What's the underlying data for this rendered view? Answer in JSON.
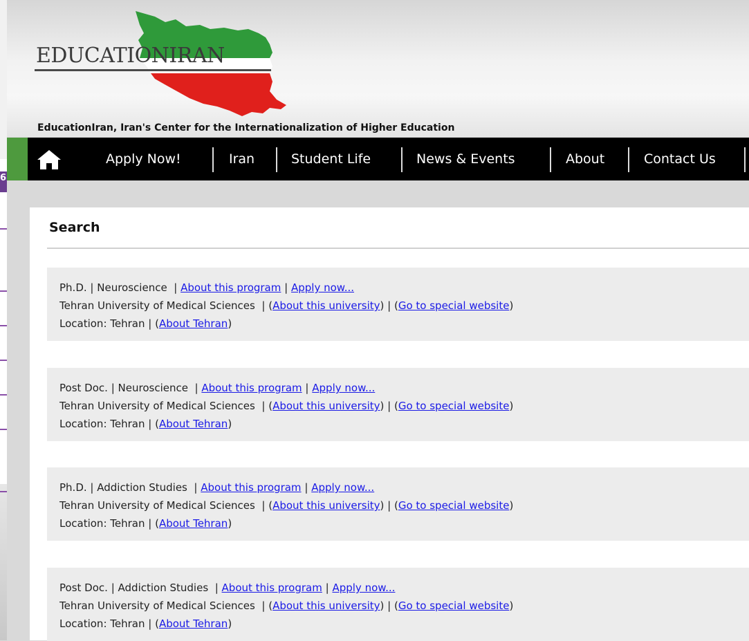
{
  "site": {
    "logo_text": "EDUCATIONIRAN",
    "tagline": "EducationIran, Iran's Center for the Internationalization of Higher Education",
    "left_tab_char": "6"
  },
  "nav": {
    "home_icon": "home-icon",
    "items": [
      {
        "label": "Apply Now!"
      },
      {
        "label": "Iran"
      },
      {
        "label": "Student Life"
      },
      {
        "label": "News & Events"
      },
      {
        "label": "About"
      },
      {
        "label": "Contact Us"
      }
    ]
  },
  "search": {
    "title": "Search"
  },
  "labels": {
    "sep": "|",
    "about_program": "About this program",
    "apply_now": "Apply now...",
    "about_university": "About this university",
    "special_website": "Go to special website",
    "location_prefix": "Location:",
    "about_city_prefix": "About"
  },
  "results": [
    {
      "degree": "Ph.D.",
      "field": "Neuroscience",
      "university": "Tehran University of Medical Sciences",
      "location": "Tehran",
      "about_city": "About Tehran"
    },
    {
      "degree": "Post Doc.",
      "field": "Neuroscience",
      "university": "Tehran University of Medical Sciences",
      "location": "Tehran",
      "about_city": "About Tehran"
    },
    {
      "degree": "Ph.D.",
      "field": "Addiction Studies",
      "university": "Tehran University of Medical Sciences",
      "location": "Tehran",
      "about_city": "About Tehran"
    },
    {
      "degree": "Post Doc.",
      "field": "Addiction Studies",
      "university": "Tehran University of Medical Sciences",
      "location": "Tehran",
      "about_city": "About Tehran"
    }
  ],
  "colors": {
    "nav_bg": "#000000",
    "nav_accent_green": "#4e9a3e",
    "link": "#1a1ae6",
    "flag_green": "#2f9a3a",
    "flag_red": "#e0201c",
    "result_bg": "#ececec"
  }
}
